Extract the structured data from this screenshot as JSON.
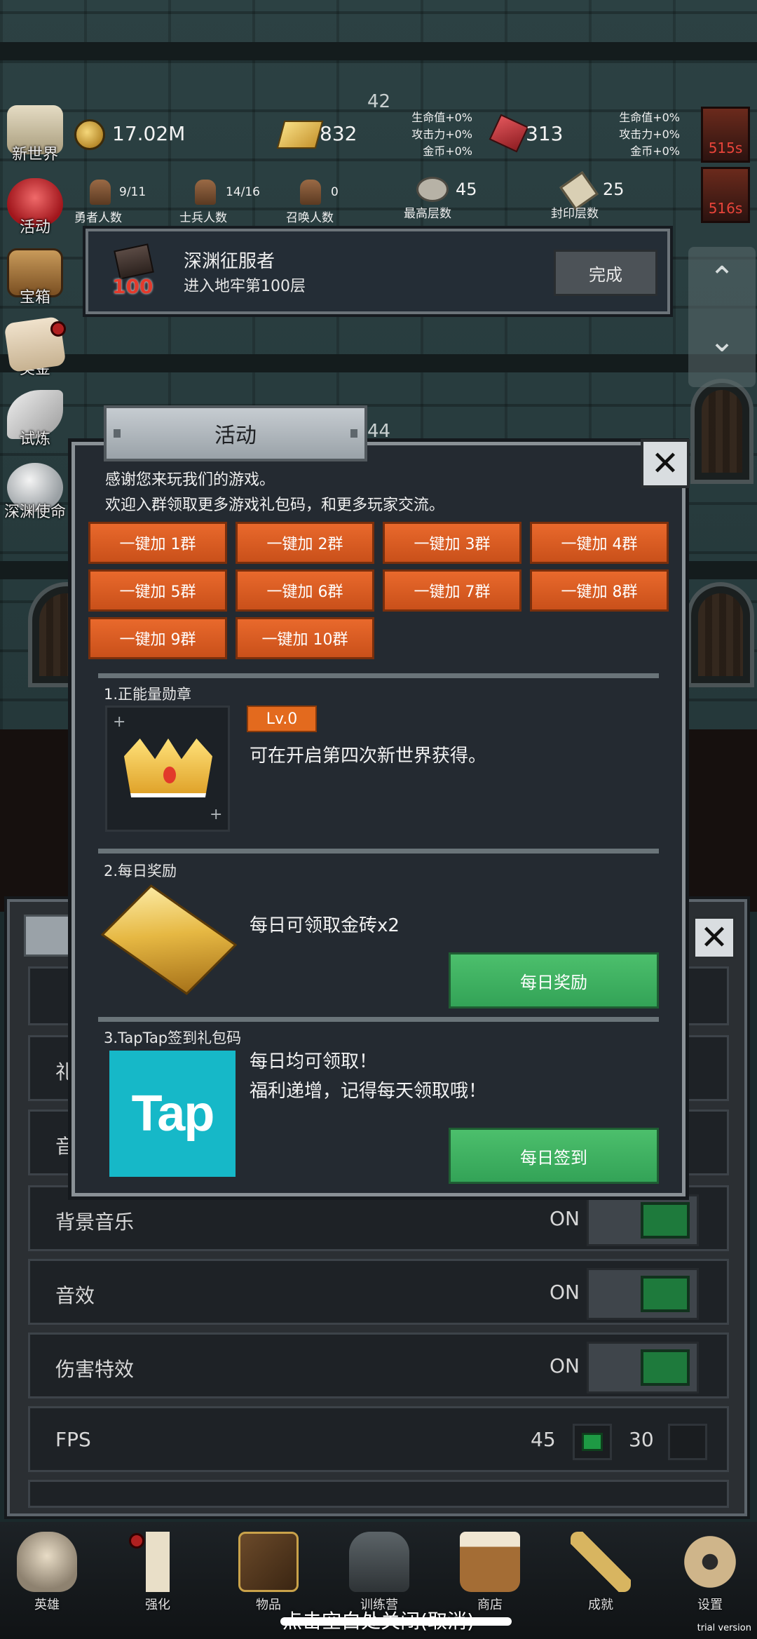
{
  "hud": {
    "floor_top": "42",
    "floor_mid": "44",
    "coins": "17.02M",
    "gold_bars": "832",
    "gems": "313",
    "bonus_left": [
      "生命值+0%",
      "攻击力+0%",
      "金币+0%"
    ],
    "bonus_right": [
      "生命值+0%",
      "攻击力+0%",
      "金币+0%"
    ],
    "stats": [
      {
        "value": "9/11",
        "label": "勇者人数"
      },
      {
        "value": "14/16",
        "label": "士兵人数"
      },
      {
        "value": "0",
        "label": "召唤人数"
      },
      {
        "value": "45",
        "label": "最高层数"
      },
      {
        "value": "25",
        "label": "封印层数"
      }
    ],
    "timers": [
      "515s",
      "516s"
    ]
  },
  "side_menu": [
    {
      "label": "新世界",
      "icon": "scroll-icon"
    },
    {
      "label": "活动",
      "icon": "heart-icon"
    },
    {
      "label": "宝箱",
      "icon": "chest-icon"
    },
    {
      "label": "奖金",
      "icon": "envelope-icon"
    },
    {
      "label": "试炼",
      "icon": "feather-icon"
    },
    {
      "label": "深渊使命",
      "icon": "orb-icon"
    }
  ],
  "toast": {
    "badge": "100",
    "title": "深渊征服者",
    "desc": "进入地牢第100层",
    "button": "完成"
  },
  "settings": {
    "rows": [
      {
        "label": "背景音乐",
        "value": "ON"
      },
      {
        "label": "音效",
        "value": "ON"
      },
      {
        "label": "伤害特效",
        "value": "ON"
      }
    ],
    "fps_label": "FPS",
    "fps_options": [
      "45",
      "30"
    ],
    "partial_labels": [
      "礼",
      "音"
    ]
  },
  "modal": {
    "title": "活动",
    "intro_1": "感谢您来玩我们的游戏。",
    "intro_2": "欢迎入群领取更多游戏礼包码，和更多玩家交流。",
    "groups": [
      "一键加 1群",
      "一键加 2群",
      "一键加 3群",
      "一键加 4群",
      "一键加 5群",
      "一键加 6群",
      "一键加 7群",
      "一键加 8群",
      "一键加 9群",
      "一键加 10群"
    ],
    "sec1_title": "1.正能量勋章",
    "sec1_level": "Lv.0",
    "sec1_text": "可在开启第四次新世界获得。",
    "sec2_title": "2.每日奖励",
    "sec2_text": "每日可领取金砖x2",
    "sec2_button": "每日奖励",
    "sec3_title": "3.TapTap签到礼包码",
    "sec3_logo": "Tap",
    "sec3_text_1": "每日均可领取！",
    "sec3_text_2": "福利递增，记得每天领取哦！",
    "sec3_button": "每日签到"
  },
  "bottom_nav": [
    {
      "label": "英雄",
      "icon": "skull-icon"
    },
    {
      "label": "强化",
      "icon": "candle-icon"
    },
    {
      "label": "物品",
      "icon": "book-icon"
    },
    {
      "label": "训练营",
      "icon": "lantern-icon"
    },
    {
      "label": "商店",
      "icon": "mug-icon"
    },
    {
      "label": "成就",
      "icon": "key-icon"
    },
    {
      "label": "设置",
      "icon": "gear-icon"
    }
  ],
  "hint": "点击空白处关闭(取消)",
  "watermark": "trial version"
}
